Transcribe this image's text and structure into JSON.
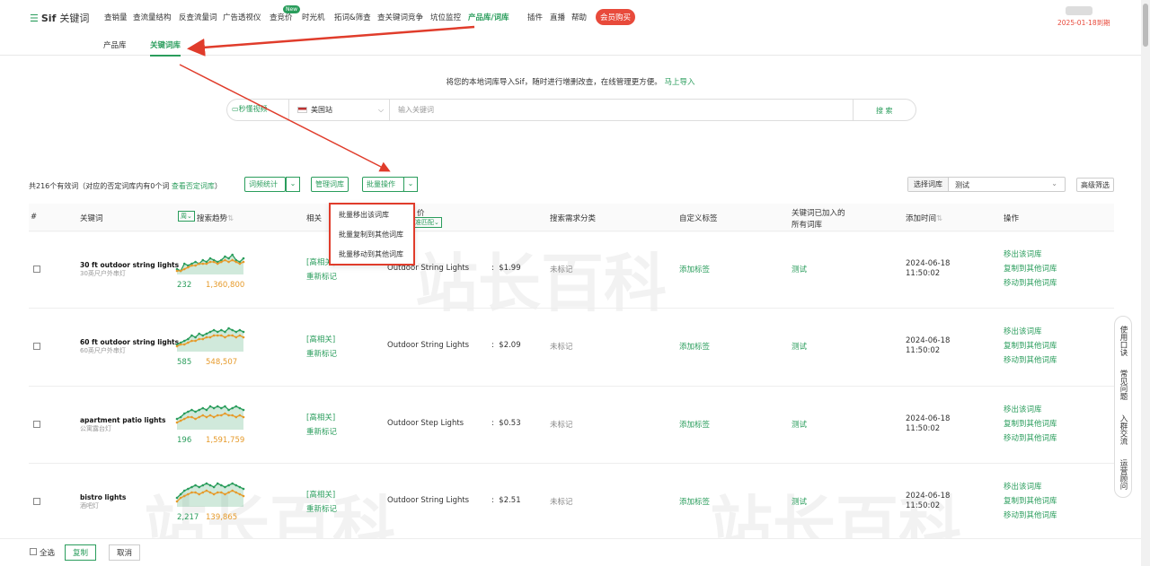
{
  "topnav": {
    "logo": "Sif",
    "logo_suffix": "关键词",
    "items": [
      "查销量",
      "查流量结构",
      "反查流量词",
      "广告透视仪",
      "查竞价",
      "时光机",
      "拓词&筛查",
      "查关键词竞争",
      "坑位监控",
      "产品库/词库",
      "插件",
      "直播",
      "帮助"
    ],
    "new_badge": "New",
    "vip": "会员购买",
    "expire": "2025-01-18到期"
  },
  "subtabs": [
    "产品库",
    "关键词库"
  ],
  "import_tip": {
    "text": "将您的本地词库导入Sif，随时进行增删改查，在线管理更方便。",
    "link": "马上导入"
  },
  "search": {
    "video": "秒懂视频",
    "site": "美国站",
    "placeholder": "输入关键词",
    "button": "搜 索"
  },
  "toolbar": {
    "summary": "共216个有效词（对应的否定词库内有0个词",
    "summary_link": "查看否定词库",
    "summary_end": "）",
    "stats": "词频统计",
    "manage": "管理词库",
    "batch": "批量操作",
    "select_label": "选择词库",
    "select_value": "测试",
    "advanced": "高级筛选"
  },
  "dropdown": [
    "批量移出该词库",
    "批量复制到其他词库",
    "批量移动到其他词库"
  ],
  "headers": {
    "num": "#",
    "keyword": "关键词",
    "toggle": "周",
    "trend": "搜索趋势",
    "rel": "相关",
    "col4": "价",
    "match": "精准匹配",
    "demand": "搜索需求分类",
    "tag": "自定义标签",
    "libs1": "关键词已加入的",
    "libs2": "所有词库",
    "time": "添加时间",
    "ops": "操作"
  },
  "rows": [
    {
      "kw": "30 ft outdoor string lights",
      "cn": "30英尺户外串灯",
      "n1": "232",
      "n2": "1,360,800",
      "rel": "[高相关]",
      "redo": "重新标记",
      "cat": "Outdoor String Lights",
      "price": "$1.99",
      "mark": "未标记",
      "add": "添加标签",
      "lib": "测试",
      "date": "2024-06-18",
      "tm": "11:50:02",
      "t1": [
        3,
        2,
        6,
        5,
        6,
        7,
        6,
        8,
        7,
        9,
        8,
        7,
        8,
        10,
        9,
        11,
        8,
        7,
        9
      ],
      "t2": [
        2,
        2,
        3,
        4,
        5,
        5,
        6,
        6,
        6,
        7,
        7,
        6,
        7,
        8,
        7,
        8,
        7,
        6,
        7
      ]
    },
    {
      "kw": "60 ft outdoor string lights",
      "cn": "60英尺户外串灯",
      "n1": "585",
      "n2": "548,507",
      "rel": "[高相关]",
      "redo": "重新标记",
      "cat": "Outdoor String Lights",
      "price": "$2.09",
      "mark": "未标记",
      "add": "添加标签",
      "lib": "测试",
      "date": "2024-06-18",
      "tm": "11:50:02",
      "t1": [
        4,
        5,
        6,
        7,
        9,
        8,
        10,
        9,
        10,
        11,
        12,
        11,
        12,
        11,
        13,
        12,
        11,
        12,
        11
      ],
      "t2": [
        3,
        4,
        4,
        5,
        6,
        6,
        7,
        7,
        8,
        8,
        9,
        9,
        9,
        8,
        9,
        9,
        8,
        9,
        8
      ]
    },
    {
      "kw": "apartment patio lights",
      "cn": "公寓露台灯",
      "n1": "196",
      "n2": "1,591,759",
      "rel": "[高相关]",
      "redo": "重新标记",
      "cat": "Outdoor Step Lights",
      "price": "$0.53",
      "mark": "未标记",
      "add": "添加标签",
      "lib": "测试",
      "date": "2024-06-18",
      "tm": "11:50:02",
      "t1": [
        6,
        7,
        9,
        10,
        11,
        10,
        11,
        12,
        11,
        13,
        12,
        13,
        12,
        13,
        11,
        12,
        13,
        12,
        11
      ],
      "t2": [
        4,
        5,
        6,
        7,
        7,
        6,
        7,
        8,
        7,
        8,
        7,
        8,
        8,
        9,
        8,
        8,
        7,
        8,
        7
      ]
    },
    {
      "kw": "bistro lights",
      "cn": "酒吧灯",
      "n1": "2,217",
      "n2": "139,865",
      "rel": "[高相关]",
      "redo": "重新标记",
      "cat": "Outdoor String Lights",
      "price": "$2.51",
      "mark": "未标记",
      "add": "添加标签",
      "lib": "测试",
      "date": "2024-06-18",
      "tm": "11:50:02",
      "t1": [
        5,
        7,
        9,
        10,
        11,
        12,
        11,
        12,
        13,
        12,
        11,
        13,
        12,
        11,
        12,
        13,
        12,
        11,
        10
      ],
      "t2": [
        3,
        5,
        6,
        7,
        8,
        8,
        7,
        8,
        9,
        8,
        7,
        8,
        8,
        7,
        8,
        9,
        8,
        7,
        6
      ]
    }
  ],
  "ops": [
    "移出该词库",
    "复制到其他词库",
    "移动到其他词库"
  ],
  "footer": {
    "select_all": "全选",
    "copy": "复制",
    "cancel": "取消"
  },
  "help_side": [
    "使用口诀",
    "常见问题",
    "入群交流",
    "运营顾问"
  ],
  "watermark": "站长百科",
  "colors": {
    "accent": "#2a9d5c",
    "orange": "#e69a2a",
    "red": "#e03c2b"
  }
}
